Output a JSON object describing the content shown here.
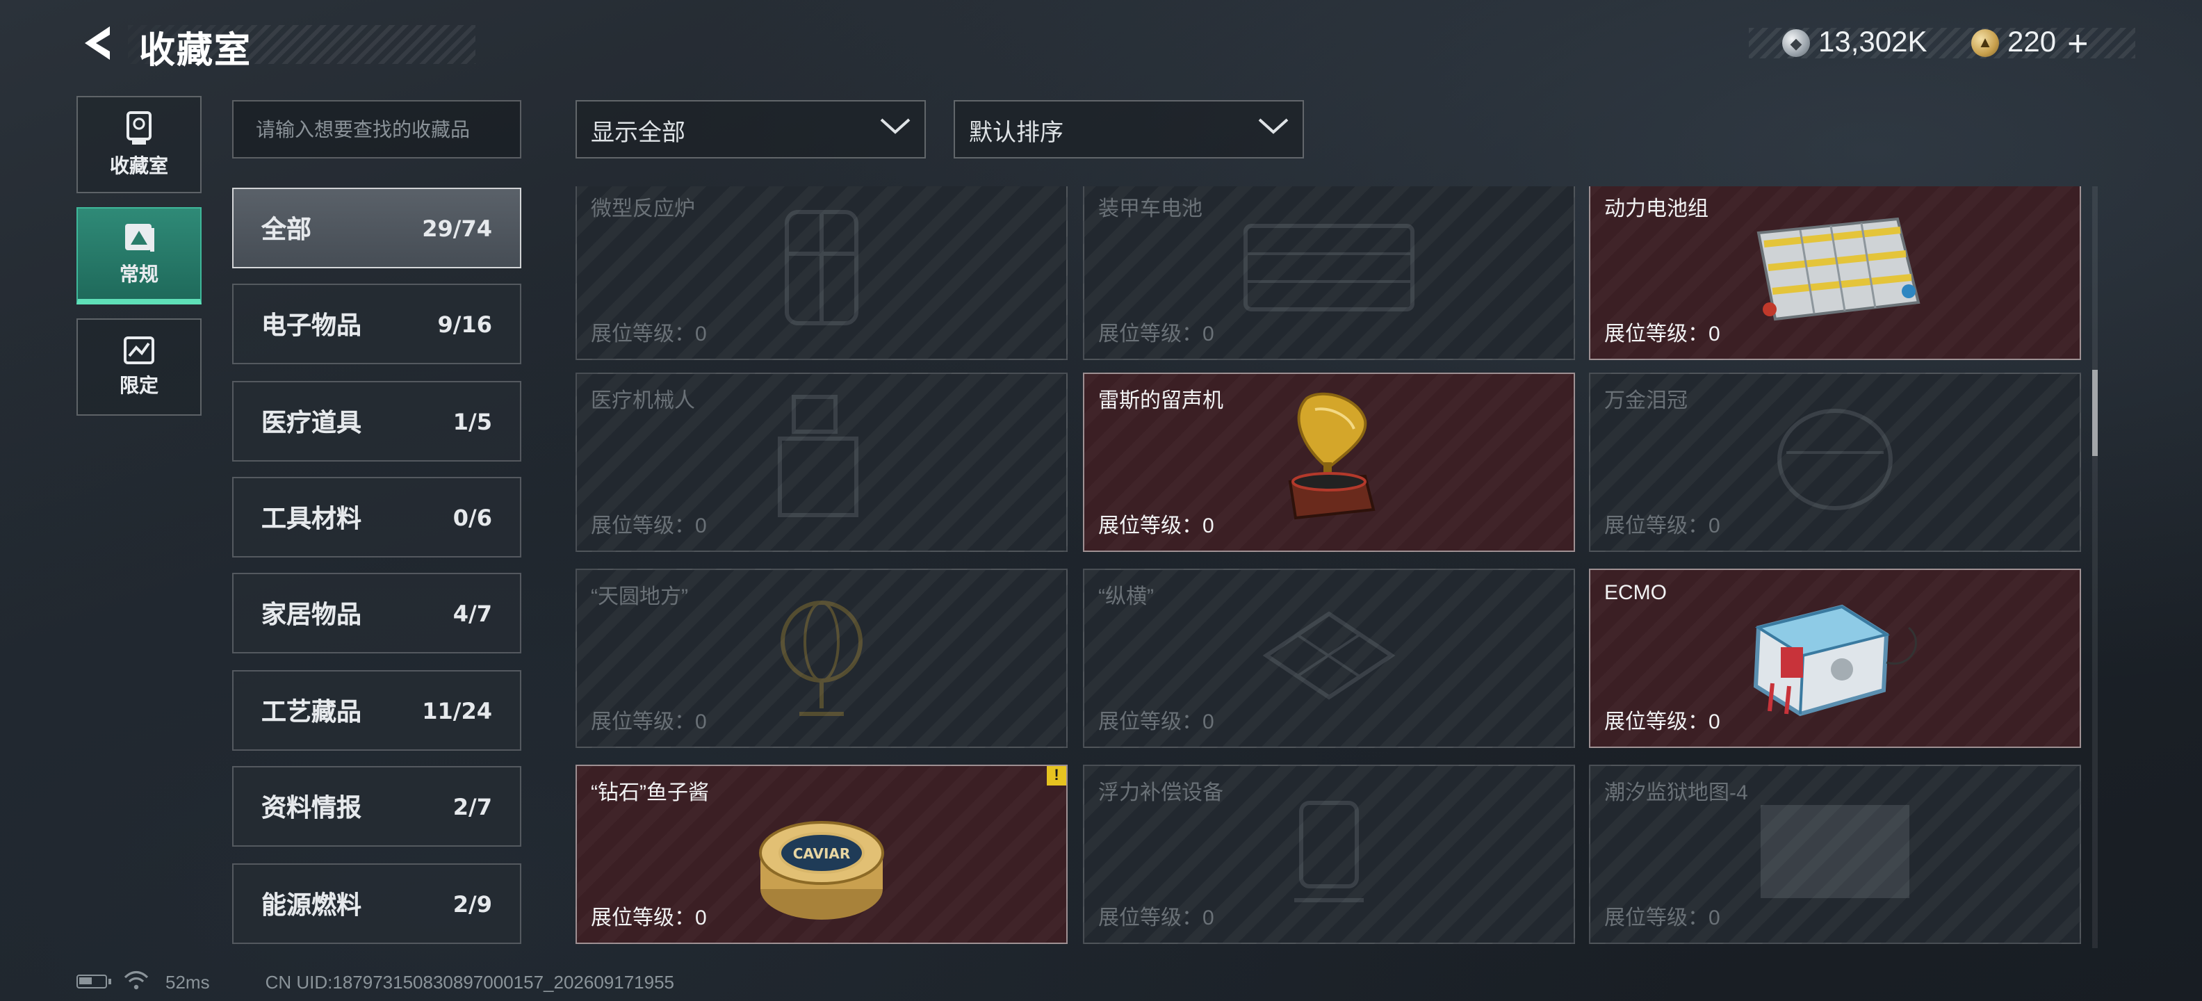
{
  "header": {
    "title": "收藏室",
    "currencies": [
      {
        "icon": "silver-coin-icon",
        "value": "13,302K"
      },
      {
        "icon": "gold-coin-icon",
        "value": "220"
      }
    ],
    "add_label": "+"
  },
  "mode_tabs": [
    {
      "label": "收藏室",
      "icon": "trophy-icon",
      "active": false
    },
    {
      "label": "常规",
      "icon": "frame-icon",
      "active": true
    },
    {
      "label": "限定",
      "icon": "limited-icon",
      "active": false
    }
  ],
  "search": {
    "placeholder": "请输入想要查找的收藏品",
    "value": ""
  },
  "categories": [
    {
      "label": "全部",
      "count": "29/74"
    },
    {
      "label": "电子物品",
      "count": "9/16"
    },
    {
      "label": "医疗道具",
      "count": "1/5"
    },
    {
      "label": "工具材料",
      "count": "0/6"
    },
    {
      "label": "家居物品",
      "count": "4/7"
    },
    {
      "label": "工艺藏品",
      "count": "11/24"
    },
    {
      "label": "资料情报",
      "count": "2/7"
    },
    {
      "label": "能源燃料",
      "count": "2/9"
    }
  ],
  "filters": {
    "display": "显示全部",
    "sort": "默认排序"
  },
  "items": [
    {
      "name": "微型反应炉",
      "level": "展位等级：0",
      "owned": false,
      "icon": "reactor-icon"
    },
    {
      "name": "装甲车电池",
      "level": "展位等级：0",
      "owned": false,
      "icon": "battery-icon"
    },
    {
      "name": "动力电池组",
      "level": "展位等级：0",
      "owned": true,
      "icon": "battery-pack-icon"
    },
    {
      "name": "医疗机械人",
      "level": "展位等级：0",
      "owned": false,
      "icon": "robot-icon"
    },
    {
      "name": "雷斯的留声机",
      "level": "展位等级：0",
      "owned": true,
      "icon": "gramophone-icon"
    },
    {
      "name": "万金泪冠",
      "level": "展位等级：0",
      "owned": false,
      "icon": "crown-icon"
    },
    {
      "name": "“天圆地方”",
      "level": "展位等级：0",
      "owned": false,
      "icon": "globe-icon"
    },
    {
      "name": "“纵横”",
      "level": "展位等级：0",
      "owned": false,
      "icon": "chessboard-icon"
    },
    {
      "name": "ECMO",
      "level": "展位等级：0",
      "owned": true,
      "icon": "ecmo-machine-icon"
    },
    {
      "name": "“钻石”鱼子酱",
      "level": "展位等级：0",
      "owned": true,
      "icon": "caviar-tin-icon",
      "alert": "!",
      "tin_text": "CAVIAR"
    },
    {
      "name": "浮力补偿设备",
      "level": "展位等级：0",
      "owned": false,
      "icon": "bcd-icon"
    },
    {
      "name": "潮汐监狱地图-4",
      "level": "展位等级：0",
      "owned": false,
      "icon": "map-icon"
    }
  ],
  "status": {
    "ping": "52ms",
    "uid": "CN UID:187973150830897000157_202609171955"
  },
  "colors": {
    "owned_card": "#3b1f24",
    "locked_card": "#22282f",
    "active_tab": "#2f8a77",
    "alert": "#e6c320"
  }
}
